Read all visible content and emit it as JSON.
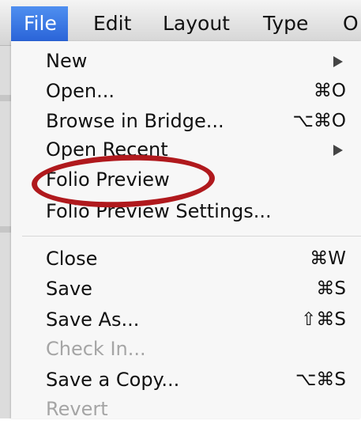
{
  "menubar": {
    "items": [
      "File",
      "Edit",
      "Layout",
      "Type",
      "O"
    ]
  },
  "file_menu": {
    "items": [
      {
        "label": "New",
        "shortcut": "",
        "submenu": true,
        "enabled": true
      },
      {
        "label": "Open...",
        "shortcut": "⌘O",
        "submenu": false,
        "enabled": true
      },
      {
        "label": "Browse in Bridge...",
        "shortcut": "⌥⌘O",
        "submenu": false,
        "enabled": true
      },
      {
        "label": "Open Recent",
        "shortcut": "",
        "submenu": true,
        "enabled": true
      },
      {
        "label": "Folio Preview",
        "shortcut": "",
        "submenu": false,
        "enabled": true
      },
      {
        "label": "Folio Preview Settings...",
        "shortcut": "",
        "submenu": false,
        "enabled": true
      },
      {
        "label": "Close",
        "shortcut": "⌘W",
        "submenu": false,
        "enabled": true
      },
      {
        "label": "Save",
        "shortcut": "⌘S",
        "submenu": false,
        "enabled": true
      },
      {
        "label": "Save As...",
        "shortcut": "⇧⌘S",
        "submenu": false,
        "enabled": true
      },
      {
        "label": "Check In...",
        "shortcut": "",
        "submenu": false,
        "enabled": false
      },
      {
        "label": "Save a Copy...",
        "shortcut": "⌥⌘S",
        "submenu": false,
        "enabled": true
      },
      {
        "label": "Revert",
        "shortcut": "",
        "submenu": false,
        "enabled": false
      }
    ]
  },
  "annotation": {
    "highlighted_item": "Folio Preview",
    "color": "#b0191d"
  },
  "colors": {
    "menubar_highlight": "#2a64d8",
    "menu_background": "#f7f7f7",
    "disabled_text": "#a5a5a5"
  }
}
